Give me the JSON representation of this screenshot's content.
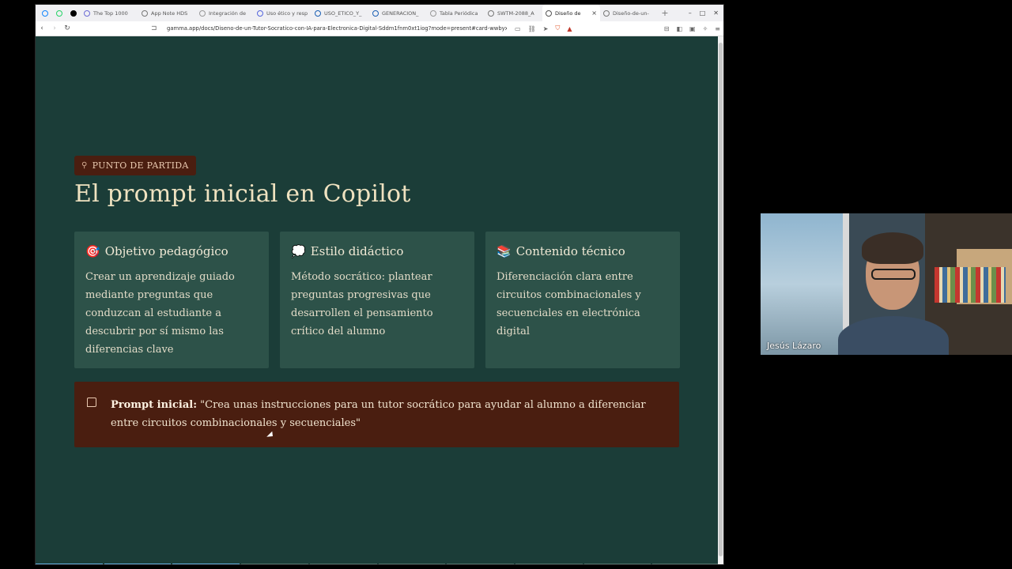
{
  "browser": {
    "tabs": [
      {
        "label": "",
        "icon": "bluesky-icon",
        "pinned": true,
        "color": "#1185fe"
      },
      {
        "label": "",
        "icon": "whatsapp-icon",
        "pinned": true,
        "color": "#25d366"
      },
      {
        "label": "",
        "icon": "x-icon",
        "pinned": true,
        "color": "#000000"
      },
      {
        "label": "The Top 1000 ",
        "icon": "page-icon",
        "color": "#6b6bd6"
      },
      {
        "label": "App Note HDS",
        "icon": "globe-icon",
        "color": "#777777"
      },
      {
        "label": "Integración de",
        "icon": "arrow-icon",
        "color": "#999999"
      },
      {
        "label": "Uso ético y resp",
        "icon": "doc-icon",
        "color": "#5566dd"
      },
      {
        "label": "USO_ETICO_Y_",
        "icon": "doc-icon",
        "color": "#1a5fb4"
      },
      {
        "label": "GENERACION_",
        "icon": "doc-icon",
        "color": "#1a5fb4"
      },
      {
        "label": "Tabla Periódica",
        "icon": "page-icon",
        "color": "#999999"
      },
      {
        "label": "SWTM-2088_A",
        "icon": "globe-icon",
        "color": "#777777"
      },
      {
        "label": "Diseño de",
        "icon": "globe-icon",
        "color": "#555555",
        "active": true
      },
      {
        "label": "Diseño-de-un-",
        "icon": "globe-icon",
        "color": "#777777"
      }
    ],
    "url": "gamma.app/docs/Diseno-de-un-Tutor-Socratico-con-IA-para-Electronica-Digital-Sddm1fnm0xt1iog?mode=present#card-wwbyxx0ovczf..."
  },
  "slide": {
    "badge": "PUNTO DE PARTIDA",
    "title": "El prompt inicial en Copilot",
    "cards": [
      {
        "emoji": "🎯",
        "heading": "Objetivo pedagógico",
        "body": "Crear un aprendizaje guiado mediante preguntas que conduzcan al estudiante a descubrir por sí mismo las diferencias clave"
      },
      {
        "emoji": "💭",
        "heading": "Estilo didáctico",
        "body": "Método socrático: plantear preguntas progresivas que desarrollen el pensamiento crítico del alumno"
      },
      {
        "emoji": "📚",
        "heading": "Contenido técnico",
        "body": "Diferenciación clara entre circuitos combinacionales y secuenciales en electrónica digital"
      }
    ],
    "callout": {
      "label": "Prompt inicial:",
      "text": " \"Crea unas instrucciones para un tutor socrático para ayudar al alumno a diferenciar entre circuitos combinacionales y secuenciales\""
    },
    "progress_total": 10,
    "progress_done": 3
  },
  "video": {
    "participant_name": "Jesús Lázaro"
  }
}
